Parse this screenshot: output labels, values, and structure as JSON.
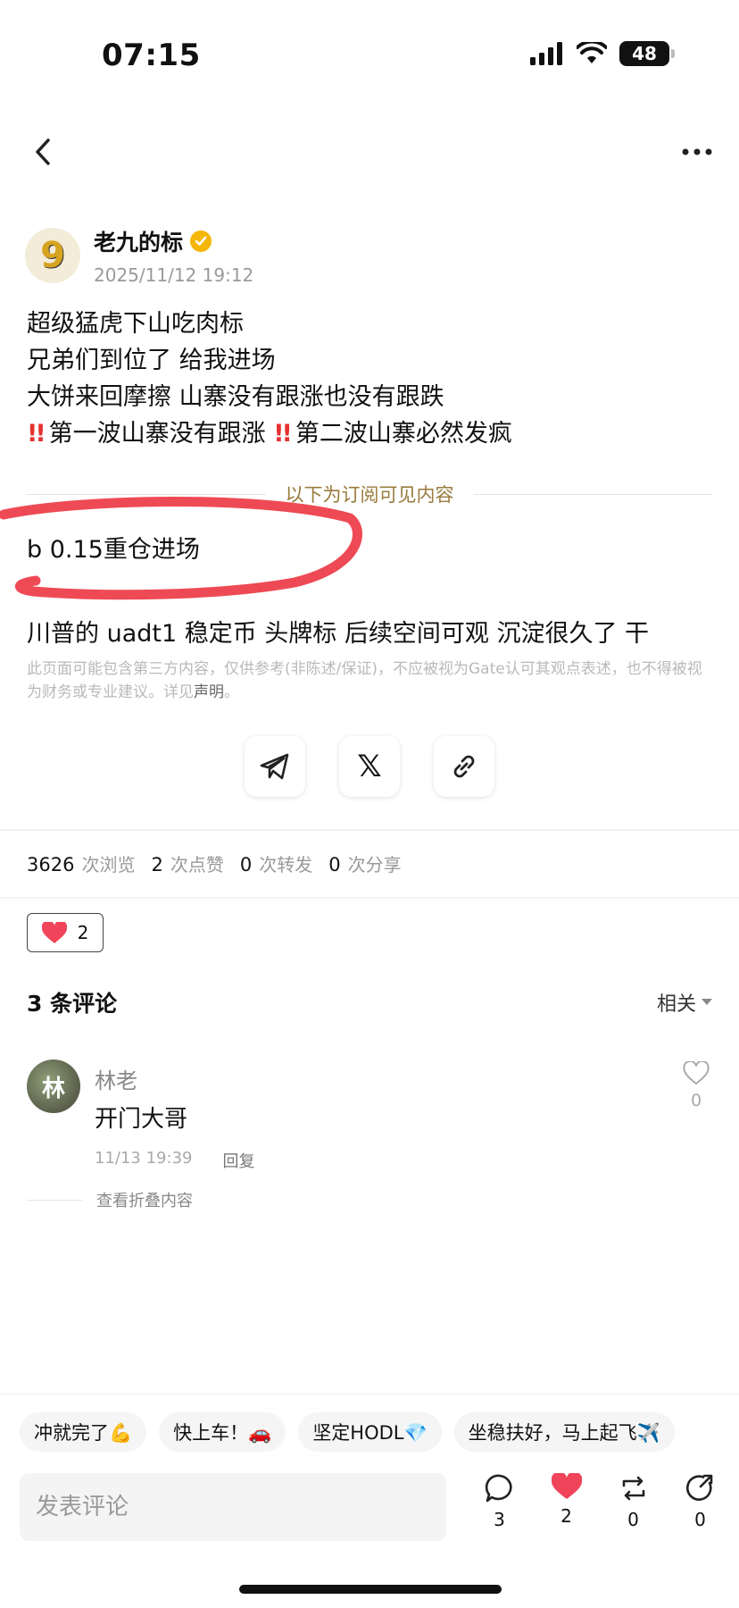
{
  "status_bar": {
    "time": "07:15",
    "battery": "48"
  },
  "author": {
    "avatar_glyph": "9",
    "name": "老九的标",
    "time": "2025/11/12 19:12"
  },
  "post": {
    "line1": "超级猛虎下山吃肉标",
    "line2": "兄弟们到位了 给我进场",
    "line3": "大饼来回摩擦 山寨没有跟涨也没有跟跌",
    "bang": "!!",
    "line4_a": "第一波山寨没有跟涨",
    "line4_b": "第二波山寨必然发疯"
  },
  "subscriber_divider": "以下为订阅可见内容",
  "subscriber": {
    "line1": "b  0.15重仓进场",
    "line2": "-",
    "line3": "川普的 uadt1 稳定币 头牌标 后续空间可观 沉淀很久了 干"
  },
  "disclaimer": {
    "text": "此页面可能包含第三方内容，仅供参考(非陈述/保证)，不应被视为Gate认可其观点表述，也不得被视为财务或专业建议。详见",
    "link": "声明",
    "end": "。"
  },
  "share": {
    "x_label": "𝕏"
  },
  "stats": {
    "views": "3626",
    "views_label": "次浏览",
    "likes": "2",
    "likes_label": "次点赞",
    "reposts": "0",
    "reposts_label": "次转发",
    "shares": "0",
    "shares_label": "次分享"
  },
  "reaction": {
    "count": "2"
  },
  "comments": {
    "title": "3 条评论",
    "sort": "相关",
    "items": [
      {
        "avatar_glyph": "林",
        "name": "林老",
        "text": "开门大哥",
        "time": "11/13 19:39",
        "reply": "回复",
        "likes": "0"
      }
    ],
    "view_folded": "查看折叠内容"
  },
  "quick_replies": [
    "冲就完了💪",
    "快上车！🚗",
    "坚定HODL💎",
    "坐稳扶好，马上起飞✈️"
  ],
  "comment_input": {
    "placeholder": "发表评论"
  },
  "actions": {
    "comments": "3",
    "likes": "2",
    "repost": "0",
    "share": "0"
  },
  "colors": {
    "like_red": "#f0445a",
    "divider_text": "#9a7b3d",
    "annotation_red": "#ee4a55"
  }
}
